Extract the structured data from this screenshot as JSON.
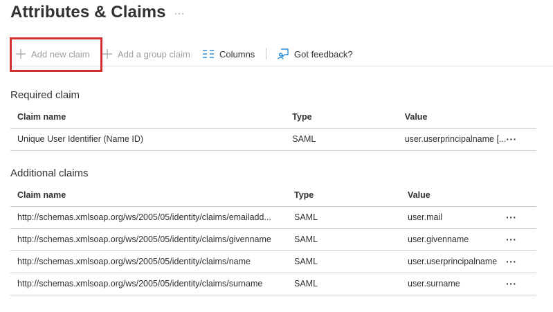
{
  "page": {
    "title": "Attributes & Claims",
    "title_more": "···"
  },
  "toolbar": {
    "add_new_claim": "Add new claim",
    "add_group_claim": "Add a group claim",
    "columns": "Columns",
    "feedback": "Got feedback?"
  },
  "required": {
    "title": "Required claim",
    "headers": {
      "name": "Claim name",
      "type": "Type",
      "value": "Value"
    },
    "rows": [
      {
        "name": "Unique User Identifier (Name ID)",
        "type": "SAML",
        "value": "user.userprincipalname [...",
        "more": "···"
      }
    ]
  },
  "additional": {
    "title": "Additional claims",
    "headers": {
      "name": "Claim name",
      "type": "Type",
      "value": "Value"
    },
    "rows": [
      {
        "name": "http://schemas.xmlsoap.org/ws/2005/05/identity/claims/emailadd...",
        "type": "SAML",
        "value": "user.mail",
        "more": "···"
      },
      {
        "name": "http://schemas.xmlsoap.org/ws/2005/05/identity/claims/givenname",
        "type": "SAML",
        "value": "user.givenname",
        "more": "···"
      },
      {
        "name": "http://schemas.xmlsoap.org/ws/2005/05/identity/claims/name",
        "type": "SAML",
        "value": "user.userprincipalname",
        "more": "···"
      },
      {
        "name": "http://schemas.xmlsoap.org/ws/2005/05/identity/claims/surname",
        "type": "SAML",
        "value": "user.surname",
        "more": "···"
      }
    ]
  },
  "icons": {
    "add": "plus-icon",
    "group": "plus-icon",
    "columns": "columns-icon",
    "feedback": "feedback-icon"
  },
  "colors": {
    "highlight": "#d32f2f",
    "accent": "#0078d4",
    "disabled_text": "#a19f9d"
  }
}
